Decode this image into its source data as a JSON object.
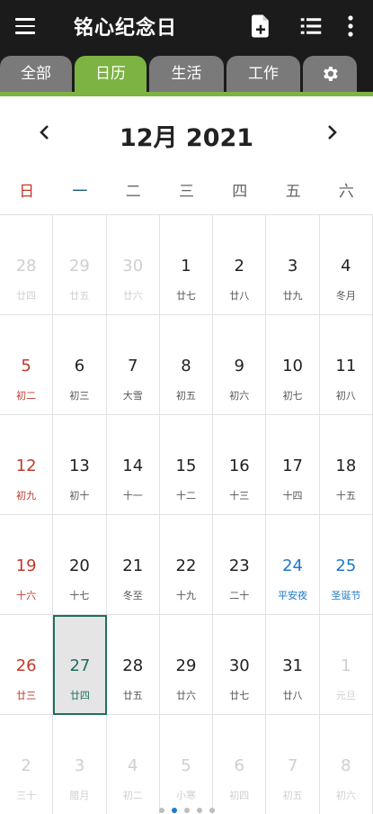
{
  "app": {
    "title": "铭心纪念日"
  },
  "tabs": [
    {
      "label": "全部",
      "active": false
    },
    {
      "label": "日历",
      "active": true
    },
    {
      "label": "生活",
      "active": false
    },
    {
      "label": "工作",
      "active": false
    },
    {
      "label": "",
      "icon": "gear-icon",
      "active": false
    }
  ],
  "calendar": {
    "month_title": "12月 2021",
    "weekdays": [
      "日",
      "一",
      "二",
      "三",
      "四",
      "五",
      "六"
    ],
    "weeks": [
      [
        {
          "day": "28",
          "lunar": "廿四",
          "other": true
        },
        {
          "day": "29",
          "lunar": "廿五",
          "other": true
        },
        {
          "day": "30",
          "lunar": "廿六",
          "other": true
        },
        {
          "day": "1",
          "lunar": "廿七"
        },
        {
          "day": "2",
          "lunar": "廿八"
        },
        {
          "day": "3",
          "lunar": "廿九"
        },
        {
          "day": "4",
          "lunar": "冬月"
        }
      ],
      [
        {
          "day": "5",
          "lunar": "初二"
        },
        {
          "day": "6",
          "lunar": "初三"
        },
        {
          "day": "7",
          "lunar": "大雪"
        },
        {
          "day": "8",
          "lunar": "初五"
        },
        {
          "day": "9",
          "lunar": "初六"
        },
        {
          "day": "10",
          "lunar": "初七"
        },
        {
          "day": "11",
          "lunar": "初八"
        }
      ],
      [
        {
          "day": "12",
          "lunar": "初九"
        },
        {
          "day": "13",
          "lunar": "初十"
        },
        {
          "day": "14",
          "lunar": "十一"
        },
        {
          "day": "15",
          "lunar": "十二"
        },
        {
          "day": "16",
          "lunar": "十三"
        },
        {
          "day": "17",
          "lunar": "十四"
        },
        {
          "day": "18",
          "lunar": "十五"
        }
      ],
      [
        {
          "day": "19",
          "lunar": "十六"
        },
        {
          "day": "20",
          "lunar": "十七"
        },
        {
          "day": "21",
          "lunar": "冬至"
        },
        {
          "day": "22",
          "lunar": "十九"
        },
        {
          "day": "23",
          "lunar": "二十"
        },
        {
          "day": "24",
          "lunar": "平安夜",
          "holiday": true
        },
        {
          "day": "25",
          "lunar": "圣诞节",
          "holiday": true
        }
      ],
      [
        {
          "day": "26",
          "lunar": "廿三"
        },
        {
          "day": "27",
          "lunar": "廿四",
          "today": true
        },
        {
          "day": "28",
          "lunar": "廿五"
        },
        {
          "day": "29",
          "lunar": "廿六"
        },
        {
          "day": "30",
          "lunar": "廿七"
        },
        {
          "day": "31",
          "lunar": "廿八"
        },
        {
          "day": "1",
          "lunar": "元旦",
          "other": true
        }
      ],
      [
        {
          "day": "2",
          "lunar": "三十",
          "other": true
        },
        {
          "day": "3",
          "lunar": "腊月",
          "other": true
        },
        {
          "day": "4",
          "lunar": "初二",
          "other": true
        },
        {
          "day": "5",
          "lunar": "小寒",
          "other": true
        },
        {
          "day": "6",
          "lunar": "初四",
          "other": true
        },
        {
          "day": "7",
          "lunar": "初五",
          "other": true
        },
        {
          "day": "8",
          "lunar": "初六",
          "other": true
        }
      ]
    ]
  },
  "colors": {
    "accent": "#7cb342",
    "sunday": "#c0392b",
    "holiday": "#1e7ac9",
    "today_border": "#1f6f5f"
  },
  "pager": {
    "count": 5,
    "active": 1
  }
}
